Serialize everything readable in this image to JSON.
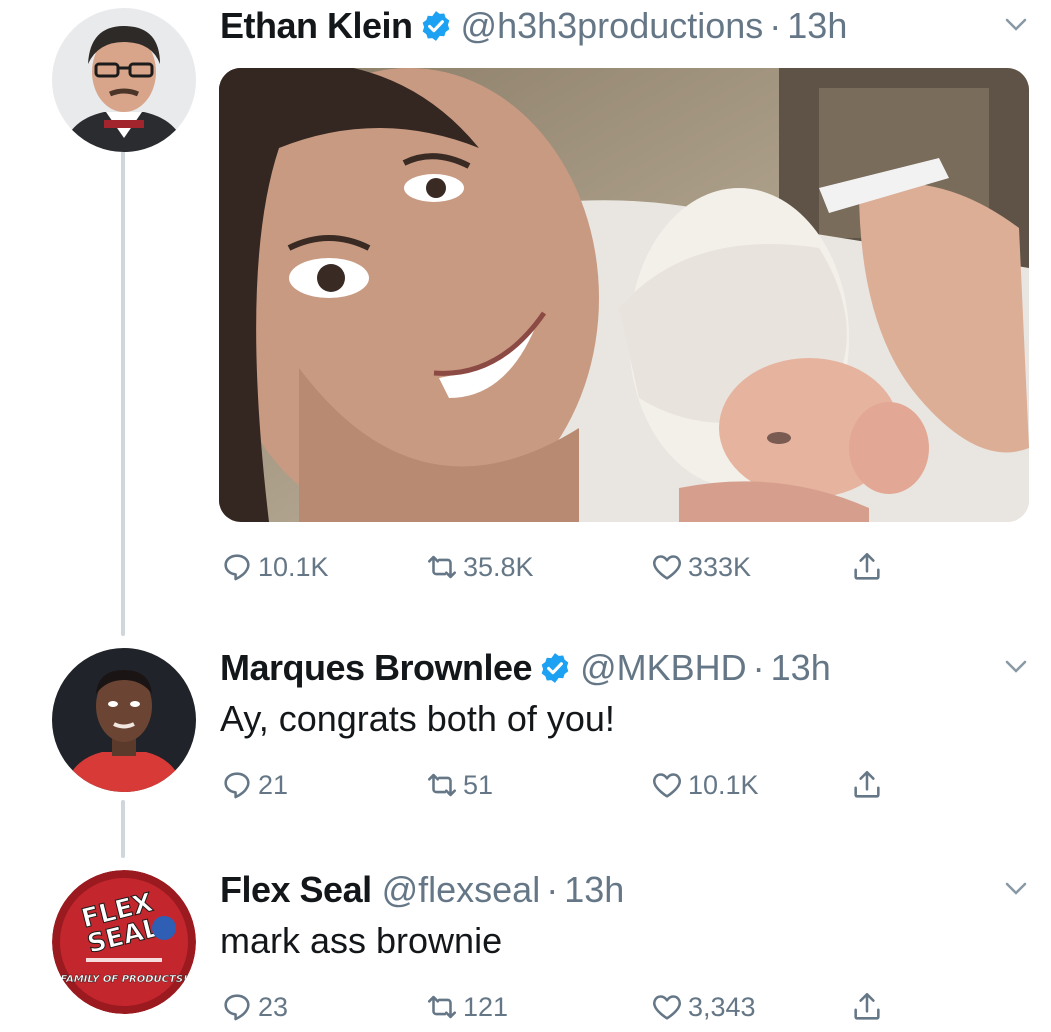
{
  "tweets": [
    {
      "name": "Ethan Klein",
      "verified": true,
      "handle": "@h3h3productions",
      "time": "13h",
      "text": "",
      "replies": "10.1K",
      "retweets": "35.8K",
      "likes": "333K"
    },
    {
      "name": "Marques Brownlee",
      "verified": true,
      "handle": "@MKBHD",
      "time": "13h",
      "text": "Ay, congrats both of you!",
      "replies": "21",
      "retweets": "51",
      "likes": "10.1K"
    },
    {
      "name": "Flex Seal",
      "verified": false,
      "handle": "@flexseal",
      "time": "13h",
      "text": "mark ass brownie",
      "replies": "23",
      "retweets": "121",
      "likes": "3,343"
    }
  ],
  "flex_seal_logo": {
    "line1": "FLEX",
    "line2": "SEAL",
    "tagline": "FAMILY OF PRODUCTS!"
  },
  "colors": {
    "verified": "#1da1f2",
    "meta_gray": "#657786",
    "thread_line": "#cfd6dc"
  },
  "icons": {
    "reply": "speech-bubble",
    "retweet": "retweet-arrows",
    "like": "heart-outline",
    "share": "share-upload",
    "caret": "chevron-down"
  }
}
